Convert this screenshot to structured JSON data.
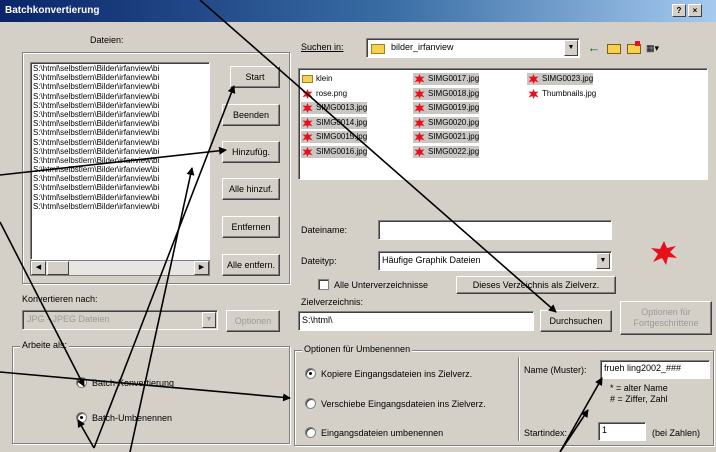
{
  "window": {
    "title": "Batchkonvertierung",
    "controls": [
      "?",
      "×"
    ]
  },
  "files_panel": {
    "label": "Dateien:",
    "files": [
      "S:\\html\\selbstlern\\Bilder\\irfanview\\bi",
      "S:\\html\\selbstlern\\Bilder\\irfanview\\bi",
      "S:\\html\\selbstlern\\Bilder\\irfanview\\bi",
      "S:\\html\\selbstlern\\Bilder\\irfanview\\bi",
      "S:\\html\\selbstlern\\Bilder\\irfanview\\bi",
      "S:\\html\\selbstlern\\Bilder\\irfanview\\bi",
      "S:\\html\\selbstlern\\Bilder\\irfanview\\bi",
      "S:\\html\\selbstlern\\Bilder\\irfanview\\bi",
      "S:\\html\\selbstlern\\Bilder\\irfanview\\bi",
      "S:\\html\\selbstlern\\Bilder\\irfanview\\bi",
      "S:\\html\\selbstlern\\Bilder\\irfanview\\bi",
      "S:\\html\\selbstlern\\Bilder\\irfanview\\bi",
      "S:\\html\\selbstlern\\Bilder\\irfanview\\bi",
      "S:\\html\\selbstlern\\Bilder\\irfanview\\bi",
      "S:\\html\\selbstlern\\Bilder\\irfanview\\bi",
      "S:\\html\\selbstlern\\Bilder\\irfanview\\bi"
    ]
  },
  "buttons": {
    "start": "Start",
    "beenden": "Beenden",
    "hinzufuegen": "Hinzufüg.",
    "alle_hinzufuegen": "Alle hinzuf.",
    "entfernen": "Entfernen",
    "alle_entfernen": "Alle entfern."
  },
  "konvertieren": {
    "label": "Konvertieren nach:",
    "format": "JPG - JPEG Dateien",
    "optionen": "Optionen"
  },
  "arbeite_als": {
    "label": "Arbeite als:",
    "options": [
      {
        "label": "Batch-Konvertierung",
        "selected": false
      },
      {
        "label": "Batch-Umbenennen",
        "selected": true
      }
    ]
  },
  "suchen_in": {
    "label": "Suchen in:",
    "folder": "bilder_irfanview"
  },
  "browser": {
    "items": [
      {
        "name": "klein",
        "type": "folder",
        "selected": false
      },
      {
        "name": "rose.png",
        "type": "image",
        "selected": false
      },
      {
        "name": "SIMG0013.jpg",
        "type": "image",
        "selected": true
      },
      {
        "name": "SIMG0014.jpg",
        "type": "image",
        "selected": true
      },
      {
        "name": "SIMG0015.jpg",
        "type": "image",
        "selected": true
      },
      {
        "name": "SIMG0016.jpg",
        "type": "image",
        "selected": true
      },
      {
        "name": "SIMG0017.jpg",
        "type": "image",
        "selected": true
      },
      {
        "name": "SIMG0018.jpg",
        "type": "image",
        "selected": true
      },
      {
        "name": "SIMG0019.jpg",
        "type": "image",
        "selected": true
      },
      {
        "name": "SIMG0020.jpg",
        "type": "image",
        "selected": true
      },
      {
        "name": "SIMG0021.jpg",
        "type": "image",
        "selected": true
      },
      {
        "name": "SIMG0022.jpg",
        "type": "image",
        "selected": true
      },
      {
        "name": "SIMG0023.jpg",
        "type": "image",
        "selected": true
      },
      {
        "name": "Thumbnails.jpg",
        "type": "image",
        "selected": false
      }
    ]
  },
  "dateiname": {
    "label": "Dateiname:",
    "value": ""
  },
  "dateityp": {
    "label": "Dateityp:",
    "value": "Häufige Graphik Dateien"
  },
  "alle_unterverzeichnisse": {
    "label": "Alle Unterverzeichnisse",
    "checked": false
  },
  "dieses_verzeichnis_button": "Dieses Verzeichnis als Zielverz.",
  "zielverzeichnis": {
    "label": "Zielverzeichnis:",
    "value": "S:\\html\\"
  },
  "durchsuchen_button": "Durchsuchen",
  "optionen_fortgeschrittene": [
    "Optionen für",
    "Fortgeschrittene"
  ],
  "umbenennen": {
    "label": "Optionen für Umbenennen",
    "options": [
      {
        "label": "Kopiere Eingangsdateien ins Zielverz.",
        "selected": true
      },
      {
        "label": "Verschiebe Eingangsdateien ins Zielverz.",
        "selected": false
      },
      {
        "label": "Eingangsdateien umbenennen",
        "selected": false
      }
    ],
    "name_muster_label": "Name (Muster):",
    "name_muster_value": "frueh ling2002_###",
    "hint_line1": "* = alter Name",
    "hint_line2": "# = Ziffer, Zahl",
    "startindex_label": "Startindex:",
    "startindex_value": "1",
    "bei_zahlen": "(bei Zahlen)"
  },
  "colors": {
    "title_start": "#0a246a",
    "title_end": "#a6caf0",
    "face": "#d4d0c8",
    "image_icon": "#e8101a"
  }
}
